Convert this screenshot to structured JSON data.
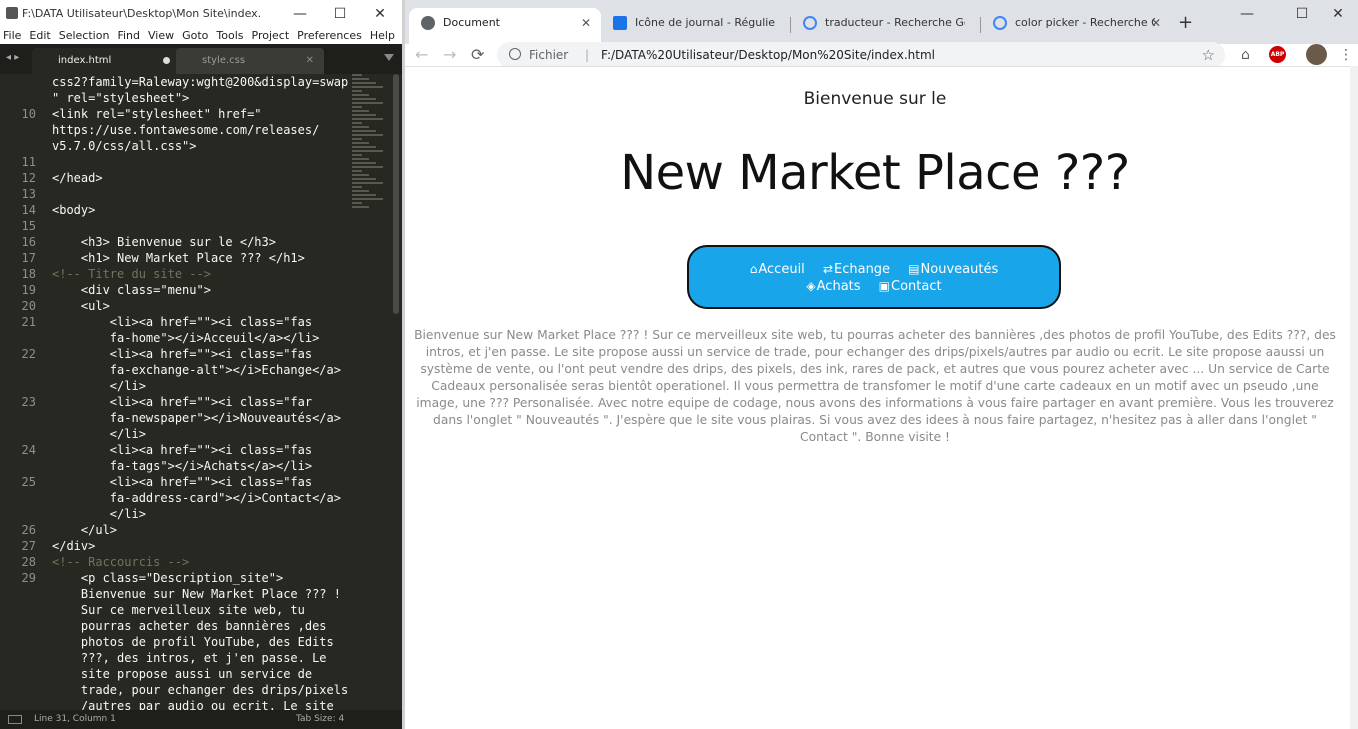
{
  "editor": {
    "title": "F:\\DATA Utilisateur\\Desktop\\Mon Site\\index.html • -...",
    "window_controls": {
      "minimize": "—",
      "maximize": "☐",
      "close": "✕"
    },
    "menu": [
      "File",
      "Edit",
      "Selection",
      "Find",
      "View",
      "Goto",
      "Tools",
      "Project",
      "Preferences",
      "Help"
    ],
    "nav_arrows": "◂ ▸",
    "tabs": [
      {
        "label": "index.html",
        "active": true,
        "modified": true
      },
      {
        "label": "style.css",
        "active": false,
        "close": "✕"
      }
    ],
    "lines": [
      {
        "num": "",
        "text": "css2?family=Raleway:wght@200&display=swap",
        "kind": "code"
      },
      {
        "num": "",
        "text": "\" rel=\"stylesheet\">",
        "kind": "code"
      },
      {
        "num": "10",
        "text": "<link rel=\"stylesheet\" href=\"",
        "kind": "code"
      },
      {
        "num": "",
        "text": "https://use.fontawesome.com/releases/",
        "kind": "code"
      },
      {
        "num": "",
        "text": "v5.7.0/css/all.css\">",
        "kind": "code"
      },
      {
        "num": "11",
        "text": "",
        "kind": "code"
      },
      {
        "num": "12",
        "text": "</head>",
        "kind": "code"
      },
      {
        "num": "13",
        "text": "",
        "kind": "code"
      },
      {
        "num": "14",
        "text": "<body>",
        "kind": "code"
      },
      {
        "num": "15",
        "text": "",
        "kind": "code"
      },
      {
        "num": "16",
        "text": "    <h3> Bienvenue sur le </h3>",
        "kind": "code"
      },
      {
        "num": "17",
        "text": "    <h1> New Market Place ??? </h1>",
        "kind": "code"
      },
      {
        "num": "18",
        "text": "<!-- Titre du site -->",
        "kind": "comment"
      },
      {
        "num": "19",
        "text": "    <div class=\"menu\">",
        "kind": "code"
      },
      {
        "num": "20",
        "text": "    <ul>",
        "kind": "code"
      },
      {
        "num": "21",
        "text": "        <li><a href=\"\"><i class=\"fas",
        "kind": "code"
      },
      {
        "num": "",
        "text": "        fa-home\"></i>Acceuil</a></li>",
        "kind": "code"
      },
      {
        "num": "22",
        "text": "        <li><a href=\"\"><i class=\"fas",
        "kind": "code"
      },
      {
        "num": "",
        "text": "        fa-exchange-alt\"></i>Echange</a>",
        "kind": "code"
      },
      {
        "num": "",
        "text": "        </li>",
        "kind": "code"
      },
      {
        "num": "23",
        "text": "        <li><a href=\"\"><i class=\"far",
        "kind": "code"
      },
      {
        "num": "",
        "text": "        fa-newspaper\"></i>Nouveautés</a>",
        "kind": "code"
      },
      {
        "num": "",
        "text": "        </li>",
        "kind": "code"
      },
      {
        "num": "24",
        "text": "        <li><a href=\"\"><i class=\"fas",
        "kind": "code"
      },
      {
        "num": "",
        "text": "        fa-tags\"></i>Achats</a></li>",
        "kind": "code"
      },
      {
        "num": "25",
        "text": "        <li><a href=\"\"><i class=\"fas",
        "kind": "code"
      },
      {
        "num": "",
        "text": "        fa-address-card\"></i>Contact</a>",
        "kind": "code"
      },
      {
        "num": "",
        "text": "        </li>",
        "kind": "code"
      },
      {
        "num": "26",
        "text": "    </ul>",
        "kind": "code"
      },
      {
        "num": "27",
        "text": "</div>",
        "kind": "code"
      },
      {
        "num": "28",
        "text": "<!-- Raccourcis -->",
        "kind": "comment"
      },
      {
        "num": "29",
        "text": "    <p class=\"Description_site\">",
        "kind": "code"
      },
      {
        "num": "",
        "text": "    Bienvenue sur New Market Place ??? !",
        "kind": "code"
      },
      {
        "num": "",
        "text": "    Sur ce merveilleux site web, tu",
        "kind": "code"
      },
      {
        "num": "",
        "text": "    pourras acheter des bannières ,des",
        "kind": "code"
      },
      {
        "num": "",
        "text": "    photos de profil YouTube, des Edits",
        "kind": "code"
      },
      {
        "num": "",
        "text": "    ???, des intros, et j'en passe. Le",
        "kind": "code"
      },
      {
        "num": "",
        "text": "    site propose aussi un service de",
        "kind": "code"
      },
      {
        "num": "",
        "text": "    trade, pour echanger des drips/pixels",
        "kind": "code"
      },
      {
        "num": "",
        "text": "    /autres par audio ou ecrit. Le site",
        "kind": "code"
      }
    ],
    "status": {
      "position": "Line 31, Column 1",
      "tab_size": "Tab Size: 4"
    }
  },
  "browser": {
    "tabs": [
      {
        "label": "Document",
        "icon": "globe-icon",
        "active": true
      },
      {
        "label": "Icône de journal - Régulier |",
        "icon": "fontawesome-icon",
        "active": false
      },
      {
        "label": "traducteur - Recherche Goo",
        "icon": "google-icon",
        "active": false
      },
      {
        "label": "color picker - Recherche Go",
        "icon": "google-icon",
        "active": false
      }
    ],
    "tab_close": "✕",
    "new_tab": "+",
    "window_controls": {
      "minimize": "—",
      "maximize": "☐",
      "close": "✕"
    },
    "nav": {
      "back": "←",
      "forward": "→",
      "reload": "⟳"
    },
    "address": {
      "scheme": "Fichier",
      "separator": "|",
      "url": "F:/DATA%20Utilisateur/Desktop/Mon%20Site/index.html",
      "star": "☆"
    },
    "toolbar_icons": {
      "home": "⌂",
      "abp": "ABP",
      "menu": "⋮"
    }
  },
  "page": {
    "h3": "Bienvenue sur le",
    "h1": "New Market Place ???",
    "menu_color": "#18a5ea",
    "menu_row1": [
      {
        "label": "Acceuil",
        "icon": "home-icon",
        "glyph": "⌂"
      },
      {
        "label": "Echange",
        "icon": "exchange-icon",
        "glyph": "⇄"
      },
      {
        "label": "Nouveautés",
        "icon": "newspaper-icon",
        "glyph": "▤"
      }
    ],
    "menu_row2": [
      {
        "label": "Achats",
        "icon": "tags-icon",
        "glyph": "◈"
      },
      {
        "label": "Contact",
        "icon": "address-card-icon",
        "glyph": "▣"
      }
    ],
    "description": "Bienvenue sur New Market Place ??? ! Sur ce merveilleux site web, tu pourras acheter des bannières ,des photos de profil YouTube, des Edits ???, des intros, et j'en passe. Le site propose aussi un service de trade, pour echanger des drips/pixels/autres par audio ou ecrit. Le site propose aaussi un système de vente, ou l'ont peut vendre des drips, des pixels, des ink, rares de pack, et autres que vous pourez acheter avec ... Un service de Carte Cadeaux personalisée seras bientôt operationel. Il vous permettra de transfomer le motif d'une carte cadeaux en un motif avec un pseudo ,une image, une ??? Personalisée. Avec notre equipe de codage, nous avons des informations à vous faire partager en avant première. Vous les trouverez dans l'onglet \" Nouveautés \". J'espère que le site vous plairas. Si vous avez des idees à nous faire partagez, n'hesitez pas à aller dans l'onglet \" Contact \". Bonne visite !"
  }
}
